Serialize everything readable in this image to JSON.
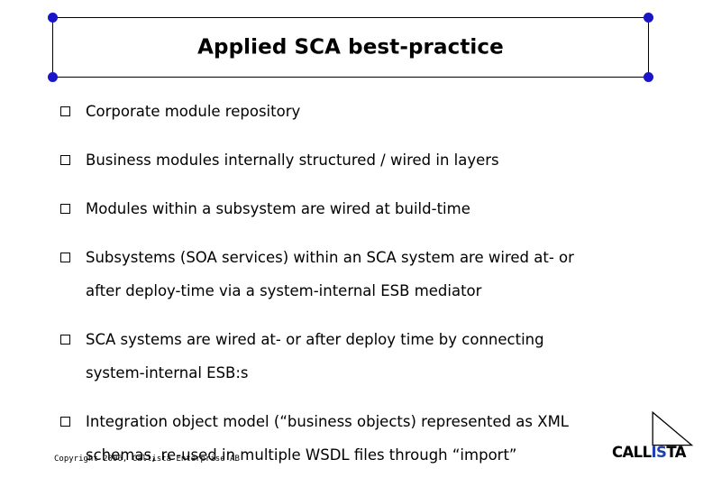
{
  "slide": {
    "background_color": "#ffffff",
    "title": "Applied SCA best-practice",
    "selection_handle_color": "#1a16c8",
    "bullets": [
      {
        "marker": "hollow-square",
        "lines": [
          "Corporate module repository"
        ]
      },
      {
        "marker": "hollow-square",
        "lines": [
          "Business modules internally structured / wired in layers"
        ]
      },
      {
        "marker": "hollow-square",
        "lines": [
          "Modules within a subsystem are wired at build-time"
        ]
      },
      {
        "marker": "hollow-square",
        "lines": [
          "Subsystems (SOA services) within an SCA system are wired at- or",
          "after deploy-time via a system-internal ESB mediator"
        ]
      },
      {
        "marker": "hollow-square",
        "lines": [
          "SCA systems are wired at- or after deploy time by connecting",
          "system-internal ESB:s"
        ]
      },
      {
        "marker": "hollow-square",
        "lines": [
          "Integration object model (“business objects) represented as XML",
          "schemas, re-used in multiple WSDL files through “import”"
        ]
      }
    ]
  },
  "footer": {
    "copyright": "Copyright 2006, Callista Enterprise AB"
  },
  "logo": {
    "name": "callista-logo",
    "word_part_1": "CALL",
    "word_part_2": "IS",
    "word_part_3": "TA",
    "accent_color": "#1f3fb0",
    "text_color": "#000000",
    "mark": "right-triangle"
  }
}
